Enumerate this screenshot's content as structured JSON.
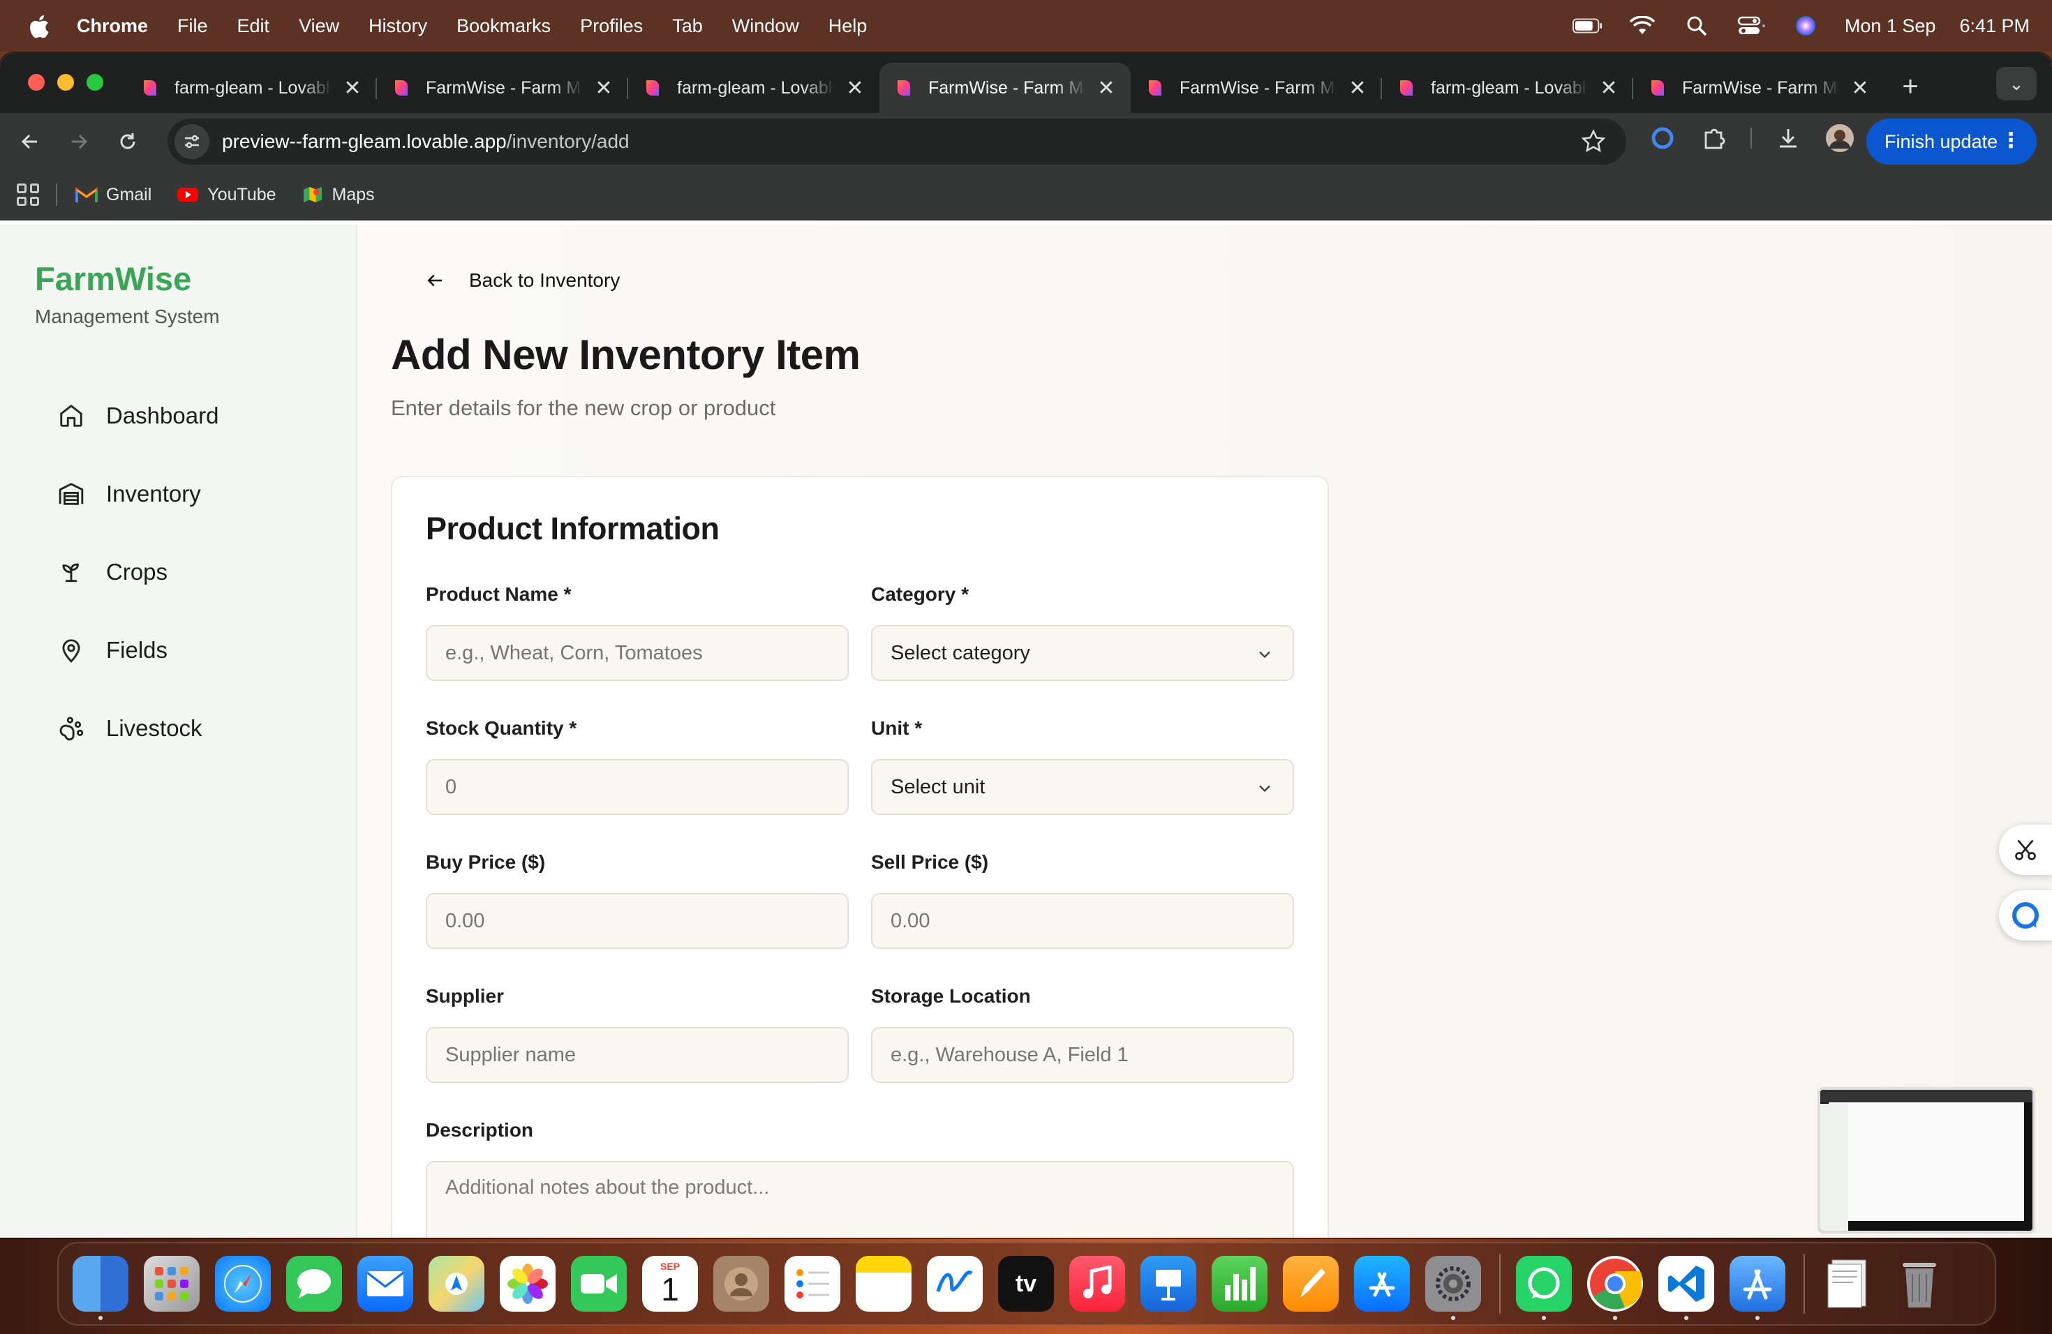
{
  "menubar": {
    "app": "Chrome",
    "items": [
      "File",
      "Edit",
      "View",
      "History",
      "Bookmarks",
      "Profiles",
      "Tab",
      "Window",
      "Help"
    ],
    "date": "Mon 1 Sep",
    "time": "6:41 PM"
  },
  "tabs": [
    {
      "title": "farm-gleam - Lovable",
      "active": false
    },
    {
      "title": "FarmWise - Farm Management",
      "active": false
    },
    {
      "title": "farm-gleam - Lovable",
      "active": false
    },
    {
      "title": "FarmWise - Farm Management",
      "active": true
    },
    {
      "title": "FarmWise - Farm Management",
      "active": false
    },
    {
      "title": "farm-gleam - Lovable",
      "active": false
    },
    {
      "title": "FarmWise - Farm Management",
      "active": false
    }
  ],
  "tab_close": "✕",
  "new_tab": "+",
  "tab_menu": "⌄",
  "address": {
    "host": "preview--farm-gleam.lovable.app",
    "path": "/inventory/add"
  },
  "finish_update": "Finish update",
  "kebab": "⋮",
  "bookmarks": [
    "Gmail",
    "YouTube",
    "Maps"
  ],
  "sidebar": {
    "brand": "FarmWise",
    "subtitle": "Management System",
    "items": [
      {
        "label": "Dashboard",
        "icon": "home-icon"
      },
      {
        "label": "Inventory",
        "icon": "warehouse-icon"
      },
      {
        "label": "Crops",
        "icon": "sprout-icon"
      },
      {
        "label": "Fields",
        "icon": "map-pin-icon"
      },
      {
        "label": "Livestock",
        "icon": "paw-icon"
      }
    ]
  },
  "main": {
    "back_label": "Back to Inventory",
    "title": "Add New Inventory Item",
    "subtitle": "Enter details for the new crop or product"
  },
  "form": {
    "section_title": "Product Information",
    "product_name": {
      "label": "Product Name *",
      "placeholder": "e.g., Wheat, Corn, Tomatoes"
    },
    "category": {
      "label": "Category *",
      "value": "Select category"
    },
    "stock_quantity": {
      "label": "Stock Quantity *",
      "placeholder": "0"
    },
    "unit": {
      "label": "Unit *",
      "value": "Select unit"
    },
    "buy_price": {
      "label": "Buy Price ($)",
      "placeholder": "0.00"
    },
    "sell_price": {
      "label": "Sell Price ($)",
      "placeholder": "0.00"
    },
    "supplier": {
      "label": "Supplier",
      "placeholder": "Supplier name"
    },
    "storage_location": {
      "label": "Storage Location",
      "placeholder": "e.g., Warehouse A, Field 1"
    },
    "description": {
      "label": "Description",
      "placeholder": "Additional notes about the product..."
    }
  },
  "dock": {
    "calendar_month": "SEP",
    "calendar_day": "1",
    "tv_label": "tv"
  },
  "colors": {
    "brand_green": "#3aa655",
    "update_blue": "#0b57d0"
  }
}
